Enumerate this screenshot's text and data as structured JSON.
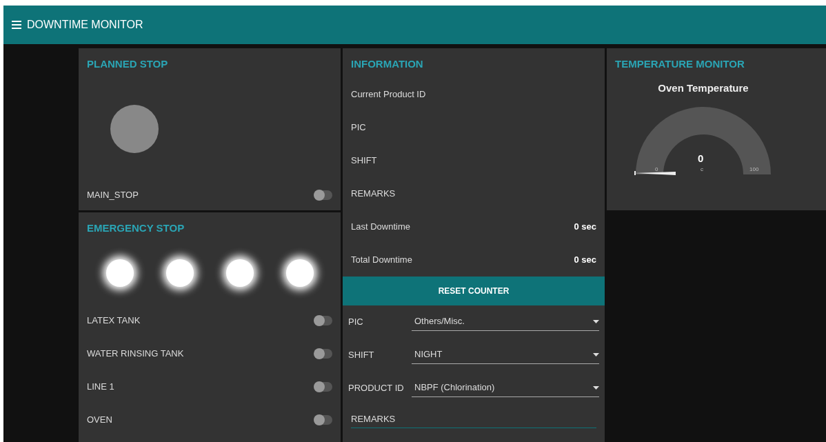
{
  "header": {
    "title": "DOWNTIME MONITOR"
  },
  "planned_stop": {
    "title": "PLANNED STOP",
    "lamp": {
      "on": false
    },
    "switches": [
      {
        "label": "MAIN_STOP",
        "on": false
      }
    ]
  },
  "emergency_stop": {
    "title": "EMERGENCY STOP",
    "lamps": [
      {
        "on": true
      },
      {
        "on": true
      },
      {
        "on": true
      },
      {
        "on": true
      }
    ],
    "switches": [
      {
        "label": "LATEX TANK",
        "on": false
      },
      {
        "label": "WATER RINSING TANK",
        "on": false
      },
      {
        "label": "LINE 1",
        "on": false
      },
      {
        "label": "OVEN",
        "on": false
      }
    ]
  },
  "information": {
    "title": "INFORMATION",
    "rows": [
      {
        "label": "Current Product ID"
      },
      {
        "label": "PIC"
      },
      {
        "label": "SHIFT"
      },
      {
        "label": "REMARKS"
      },
      {
        "label": "Last Downtime",
        "value": "0 sec"
      },
      {
        "label": "Total Downtime",
        "value": "0 sec"
      }
    ],
    "button": "RESET COUNTER",
    "dropdowns": [
      {
        "label": "PIC",
        "value": "Others/Misc."
      },
      {
        "label": "SHIFT",
        "value": "NIGHT"
      },
      {
        "label": "PRODUCT ID",
        "value": "NBPF (Chlorination)"
      }
    ],
    "remarks": {
      "placeholder": "REMARKS"
    }
  },
  "temperature": {
    "title": "TEMPERATURE MONITOR",
    "gauge": {
      "title": "Oven Temperature",
      "value": "0",
      "units": "c",
      "min": "0",
      "max": "100",
      "level": 0
    }
  }
}
